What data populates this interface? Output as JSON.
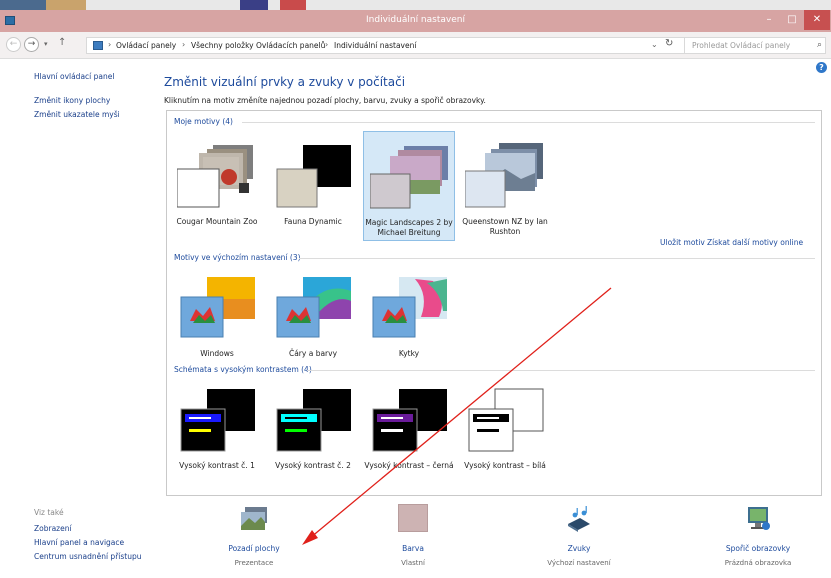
{
  "window": {
    "title": "Individuální nastavení",
    "minimize_glyph": "–",
    "maximize_glyph": "□",
    "close_glyph": "✕"
  },
  "addressbar": {
    "back_glyph": "←",
    "forward_glyph": "→",
    "recent_glyph": "▾",
    "up_glyph": "↑",
    "breadcrumb": [
      "Ovládací panely",
      "Všechny položky Ovládacích panelů",
      "Individuální nastavení"
    ],
    "separator": "›",
    "dropdown_glyph": "⌄",
    "refresh_glyph": "↻",
    "search_placeholder": "Prohledat Ovládací panely",
    "search_glyph": "⌕"
  },
  "help_glyph": "?",
  "sidebar": {
    "links": [
      "Hlavní ovládací panel",
      "Změnit ikony plochy",
      "Změnit ukazatele myši"
    ],
    "see_also_label": "Viz také",
    "see_also_links": [
      "Zobrazení",
      "Hlavní panel a navigace",
      "Centrum usnadnění přístupu"
    ]
  },
  "main": {
    "title": "Změnit vizuální prvky a zvuky v počítači",
    "description": "Kliknutím na motiv změníte najednou pozadí plochy, barvu, zvuky a spořič obrazovky."
  },
  "sections": {
    "my_themes": {
      "header": "Moje motivy (4)",
      "themes": [
        {
          "name": "Cougar Mountain Zoo",
          "icon": "zoo-photo-stack"
        },
        {
          "name": "Fauna Dynamic",
          "icon": "dark-theme-stack"
        },
        {
          "name": "Magic Landscapes 2 by Michael Breitung",
          "icon": "landscape-photo-stack"
        },
        {
          "name": "Queenstown NZ by Ian Rushton",
          "icon": "mountain-photo-stack"
        }
      ],
      "save_link": "Uložit motiv",
      "online_link": "Získat další motivy online"
    },
    "default_themes": {
      "header": "Motivy ve výchozím nastavení (3)",
      "themes": [
        {
          "name": "Windows",
          "icon": "windows-theme"
        },
        {
          "name": "Čáry a barvy",
          "icon": "lines-colors-theme"
        },
        {
          "name": "Kytky",
          "icon": "flowers-theme"
        }
      ]
    },
    "high_contrast": {
      "header": "Schémata s vysokým kontrastem (4)",
      "themes": [
        {
          "name": "Vysoký kontrast č. 1",
          "icon": "high-contrast-1",
          "accent": "#1a1aff",
          "bar2": "#ffff00"
        },
        {
          "name": "Vysoký kontrast č. 2",
          "icon": "high-contrast-2",
          "accent": "#00ffff",
          "bar2": "#00ff00"
        },
        {
          "name": "Vysoký kontrast – černá",
          "icon": "high-contrast-black",
          "accent": "#6a1b9a",
          "bar2": "#ffffff"
        },
        {
          "name": "Vysoký kontrast – bílá",
          "icon": "high-contrast-white",
          "accent": "#000000",
          "bar2": "#000000"
        }
      ]
    }
  },
  "bottom_tiles": [
    {
      "label": "Pozadí plochy",
      "sub": "Prezentace",
      "icon": "desktop-background-icon"
    },
    {
      "label": "Barva",
      "sub": "Vlastní",
      "icon": "color-icon",
      "color": "#cdb3b3"
    },
    {
      "label": "Zvuky",
      "sub": "Výchozí nastavení",
      "icon": "sounds-icon"
    },
    {
      "label": "Spořič obrazovky",
      "sub": "Prázdná obrazovka",
      "icon": "screensaver-icon"
    }
  ],
  "colors": {
    "titlebar": "#d7a4a3",
    "link": "#1d4a9c",
    "selection": "#d5e8f7",
    "annotation_arrow": "#e0201a"
  }
}
